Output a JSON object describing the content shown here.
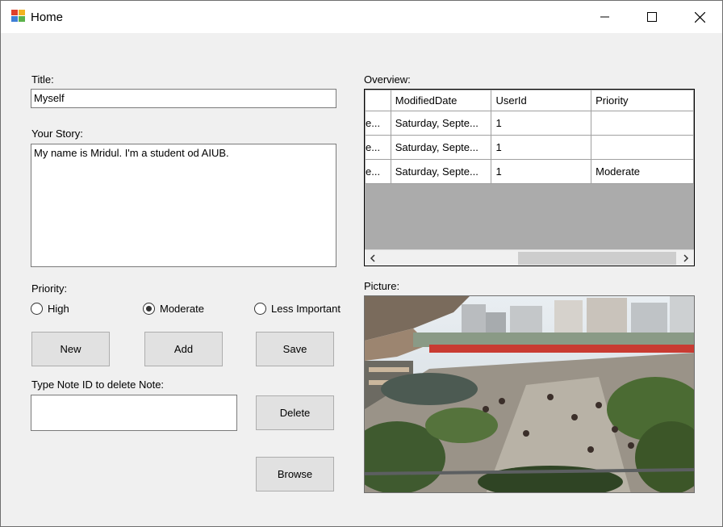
{
  "window": {
    "title": "Home"
  },
  "form": {
    "title_label": "Title:",
    "title_value": "Myself",
    "story_label": "Your Story:",
    "story_value": "My name is Mridul. I'm a student od AIUB.",
    "priority_label": "Priority:",
    "priority_options": [
      {
        "label": "High",
        "selected": false
      },
      {
        "label": "Moderate",
        "selected": true
      },
      {
        "label": "Less Important",
        "selected": false
      }
    ],
    "buttons": {
      "new": "New",
      "add": "Add",
      "save": "Save",
      "delete": "Delete",
      "browse": "Browse"
    },
    "delete_label": "Type Note ID to delete Note:",
    "delete_value": ""
  },
  "overview": {
    "label": "Overview:",
    "columns": [
      "",
      "ModifiedDate",
      "UserId",
      "Priority"
    ],
    "rows": [
      [
        "e...",
        "Saturday, Septe...",
        "1",
        ""
      ],
      [
        "e...",
        "Saturday, Septe...",
        "1",
        ""
      ],
      [
        "e...",
        "Saturday, Septe...",
        "1",
        "Moderate"
      ]
    ]
  },
  "picture": {
    "label": "Picture:"
  },
  "colors": {
    "window_bg": "#f0f0f0",
    "button_bg": "#e1e1e1",
    "grid_empty": "#ababab"
  }
}
